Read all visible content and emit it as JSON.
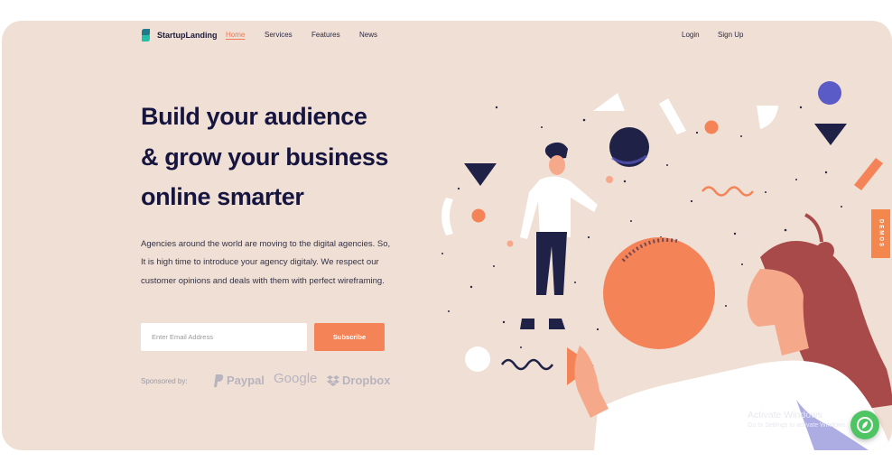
{
  "brand": {
    "name": "StartupLanding"
  },
  "nav": {
    "links": [
      "Home",
      "Services",
      "Features",
      "News"
    ],
    "login": "Login",
    "signup": "Sign Up"
  },
  "hero": {
    "headline": [
      "Build your audience",
      "& grow your business",
      "online smarter"
    ],
    "description": "Agencies around the world are moving to the digital agencies. So, It is high time to introduce your agency digitaly. We respect our customer opinions and deals with them with perfect wireframing."
  },
  "form": {
    "email_placeholder": "Enter Email Address",
    "subscribe_label": "Subscribe"
  },
  "sponsors": {
    "label": "Sponsored by:",
    "brands": [
      "Paypal",
      "Google",
      "Dropbox"
    ]
  },
  "side_tab": {
    "label": "DEMOS"
  },
  "watermark": {
    "title": "Activate Windows",
    "subtitle": "Go to Settings to activate Windows."
  },
  "colors": {
    "background": "#f0dfd4",
    "navy": "#151540",
    "accent": "#f58358",
    "purple": "#5b5bc7",
    "hair": "#a84a4a",
    "chat": "#4fc463"
  },
  "icons": {
    "logo": "startuplanding-logo-icon",
    "paypal": "paypal-icon",
    "dropbox": "dropbox-icon",
    "chat": "chat-leaf-icon"
  }
}
